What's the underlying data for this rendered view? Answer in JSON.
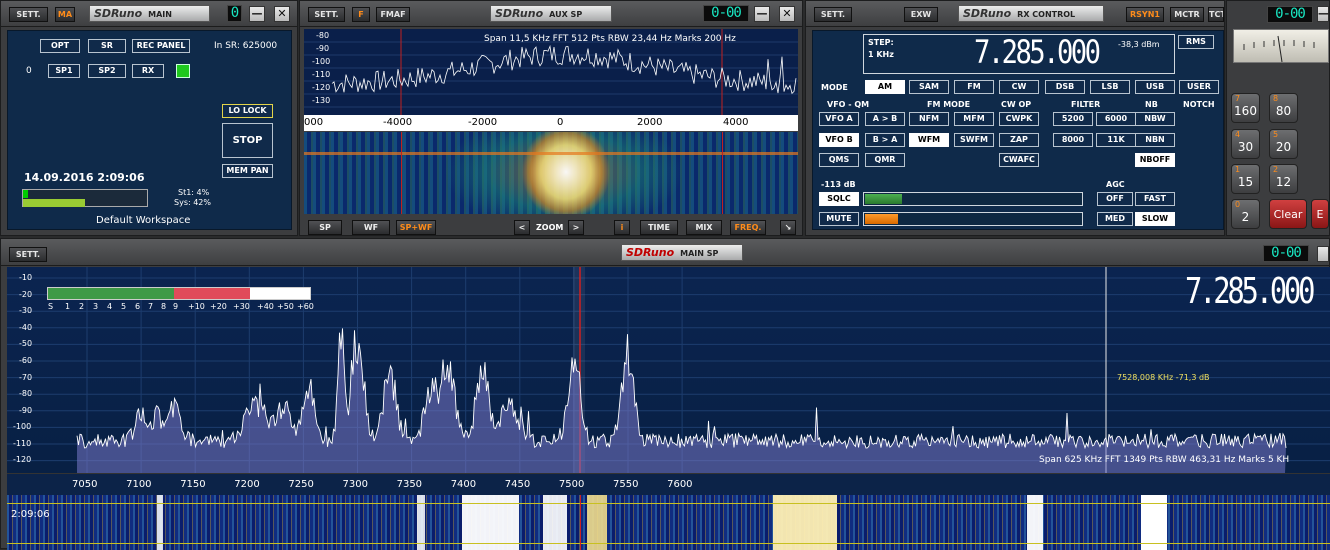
{
  "main": {
    "sett": "SETT.",
    "ma": "MA",
    "logo_brand": "SDRuno",
    "title": "MAIN",
    "seg": "0",
    "min": "—",
    "close": "✕",
    "btn_opt": "OPT",
    "btn_sr": "SR",
    "btn_rec_panel": "REC PANEL",
    "in_sr": "In SR: 625000",
    "row_idx": "0",
    "btn_sp1": "SP1",
    "btn_sp2": "SP2",
    "btn_rx": "RX",
    "btn_lo_lock": "LO LOCK",
    "btn_stop": "STOP",
    "btn_mem_pan": "MEM PAN",
    "datetime": "14.09.2016 2:09:06",
    "st1": "St1: 4%",
    "sys": "Sys: 42%",
    "st1_level": 0.04,
    "sys_level": 0.42,
    "workspace": "Default Workspace"
  },
  "aux": {
    "sett": "SETT.",
    "f": "F",
    "fmaf": "FMAF",
    "logo_brand": "SDRuno",
    "title": "AUX SP",
    "seg": "0-00",
    "min": "—",
    "close": "✕",
    "info": "Span 11,5 KHz   FFT 512 Pts   RBW 23,44 Hz   Marks 200 Hz",
    "y_ticks": [
      "-80",
      "-90",
      "-100",
      "-110",
      "-120",
      "-130"
    ],
    "x_ticks": [
      "000",
      "-4000",
      "-2000",
      "0",
      "2000",
      "4000"
    ],
    "btn_sp": "SP",
    "btn_wf": "WF",
    "btn_spwf": "SP+WF",
    "zoom_left": "<",
    "zoom": "ZOOM",
    "zoom_right": ">",
    "btn_i": "i",
    "btn_time": "TIME",
    "btn_mix": "MIX",
    "btn_freq": "FREQ.",
    "resize": "↘"
  },
  "rx": {
    "sett": "SETT.",
    "exw": "EXW",
    "logo_brand": "SDRuno",
    "title": "RX CONTROL",
    "rsyn": "RSYN1",
    "mctr": "MCTR",
    "tctr": "TCTR",
    "seg": "0-00",
    "min": "—",
    "close": "✕",
    "step_label": "STEP:",
    "step_value": "1 KHz",
    "frequency": "7.285.000",
    "level": "-38,3 dBm",
    "btn_rms": "RMS",
    "mode_label": "MODE",
    "modes": [
      "AM",
      "SAM",
      "FM",
      "CW",
      "DSB",
      "LSB",
      "USB",
      "USER"
    ],
    "vfo_qm": "VFO - QM",
    "fm_mode": "FM MODE",
    "cw_op": "CW OP",
    "filter": "FILTER",
    "nb": "NB",
    "notch": "NOTCH",
    "btn_vfoa": "VFO A",
    "btn_atob": "A > B",
    "btn_nfm": "NFM",
    "btn_mfm": "MFM",
    "btn_cwpk": "CWPK",
    "btn_5200": "5200",
    "btn_6000": "6000",
    "btn_nbw": "NBW",
    "btn_vfob": "VFO B",
    "btn_btoa": "B > A",
    "btn_wfm": "WFM",
    "btn_swfm": "SWFM",
    "btn_zap": "ZAP",
    "btn_8000": "8000",
    "btn_11k": "11K",
    "btn_nbn": "NBN",
    "btn_qms": "QMS",
    "btn_qmr": "QMR",
    "btn_cwafc": "CWAFC",
    "btn_nboff": "NBOFF",
    "sq_db": "-113 dB",
    "agc": "AGC",
    "btn_sqlc": "SQLC",
    "btn_off": "OFF",
    "btn_fast": "FAST",
    "btn_mute": "MUTE",
    "btn_med": "MED",
    "btn_slow": "SLOW",
    "sql_level": 0.08,
    "vol_level": 0.15
  },
  "keypad": {
    "keys": [
      {
        "k": "7",
        "v": "160"
      },
      {
        "k": "8",
        "v": "80"
      },
      {
        "k": "4",
        "v": "30"
      },
      {
        "k": "5",
        "v": "20"
      },
      {
        "k": "1",
        "v": "15"
      },
      {
        "k": "2",
        "v": "12"
      },
      {
        "k": "0",
        "v": "2"
      }
    ],
    "clear": "Clear",
    "enter": "E"
  },
  "mainsp": {
    "sett": "SETT.",
    "logo_brand": "SDRuno",
    "title": "MAIN SP",
    "seg": "0-00",
    "frequency": "7.285.000",
    "y_ticks": [
      "-10",
      "-20",
      "-30",
      "-40",
      "-50",
      "-60",
      "-70",
      "-80",
      "-90",
      "-100",
      "-110",
      "-120"
    ],
    "smeter": [
      "S",
      "1",
      "2",
      "3",
      "4",
      "5",
      "6",
      "7",
      "8",
      "9",
      "+10",
      "+20",
      "+30",
      "+40",
      "+50",
      "+60"
    ],
    "x_ticks": [
      "7050",
      "7100",
      "7150",
      "7200",
      "7250",
      "7300",
      "7350",
      "7400",
      "7450",
      "7500",
      "7550",
      "7600"
    ],
    "cursor": "7528,008 KHz -71,3 dB",
    "info": "Span 625 KHz   FFT 1349 Pts   RBW 463,31 Hz   Marks 5 KH",
    "wf_time": "2:09:06"
  }
}
